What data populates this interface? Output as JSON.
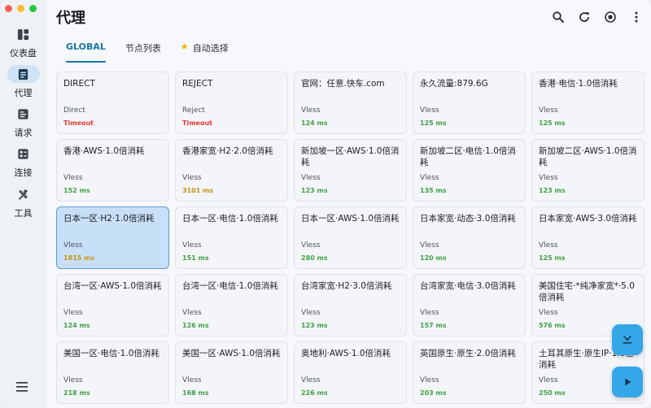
{
  "window": {
    "title": "代理"
  },
  "sidebar": {
    "items": [
      {
        "label": "仪表盘",
        "icon": "dashboard-icon",
        "active": false
      },
      {
        "label": "代理",
        "icon": "proxy-icon",
        "active": true
      },
      {
        "label": "请求",
        "icon": "requests-icon",
        "active": false
      },
      {
        "label": "连接",
        "icon": "connections-icon",
        "active": false
      },
      {
        "label": "工具",
        "icon": "tools-icon",
        "active": false
      }
    ],
    "menu_icon": "menu-icon"
  },
  "header": {
    "actions": [
      "search-icon",
      "refresh-icon",
      "target-icon",
      "more-vert-icon"
    ]
  },
  "tabs": [
    {
      "label": "GLOBAL",
      "active": true
    },
    {
      "label": "节点列表",
      "active": false
    },
    {
      "label": "自动选择",
      "active": false,
      "icon": "star-icon"
    }
  ],
  "nodes": [
    {
      "name": "DIRECT",
      "type": "Direct",
      "delay": "Timeout",
      "status": "bad"
    },
    {
      "name": "REJECT",
      "type": "Reject",
      "delay": "Timeout",
      "status": "bad"
    },
    {
      "name": "官网：任意.快车.com",
      "type": "Vless",
      "delay": "124 ms",
      "status": "good"
    },
    {
      "name": "永久流量:879.6G",
      "type": "Vless",
      "delay": "125 ms",
      "status": "good"
    },
    {
      "name": "香港·电信·1.0倍消耗",
      "type": "Vless",
      "delay": "125 ms",
      "status": "good"
    },
    {
      "name": "香港·AWS·1.0倍消耗",
      "type": "Vless",
      "delay": "152 ms",
      "status": "good"
    },
    {
      "name": "香港家宽·H2·2.0倍消耗",
      "type": "Vless",
      "delay": "3101 ms",
      "status": "warn"
    },
    {
      "name": "新加坡一区·AWS·1.0倍消耗",
      "type": "Vless",
      "delay": "123 ms",
      "status": "good"
    },
    {
      "name": "新加坡二区·电信·1.0倍消耗",
      "type": "Vless",
      "delay": "135 ms",
      "status": "good"
    },
    {
      "name": "新加坡二区·AWS·1.0倍消耗",
      "type": "Vless",
      "delay": "123 ms",
      "status": "good"
    },
    {
      "name": "日本一区·H2·1.0倍消耗",
      "type": "Vless",
      "delay": "1815 ms",
      "status": "warn",
      "selected": true
    },
    {
      "name": "日本一区·电信·1.0倍消耗",
      "type": "Vless",
      "delay": "151 ms",
      "status": "good"
    },
    {
      "name": "日本一区·AWS·1.0倍消耗",
      "type": "Vless",
      "delay": "280 ms",
      "status": "good"
    },
    {
      "name": "日本家宽·动态·3.0倍消耗",
      "type": "Vless",
      "delay": "120 ms",
      "status": "good"
    },
    {
      "name": "日本家宽·AWS·3.0倍消耗",
      "type": "Vless",
      "delay": "125 ms",
      "status": "good"
    },
    {
      "name": "台湾一区·AWS·1.0倍消耗",
      "type": "Vless",
      "delay": "124 ms",
      "status": "good"
    },
    {
      "name": "台湾一区·电信·1.0倍消耗",
      "type": "Vless",
      "delay": "126 ms",
      "status": "good"
    },
    {
      "name": "台湾家宽·H2·3.0倍消耗",
      "type": "Vless",
      "delay": "123 ms",
      "status": "good"
    },
    {
      "name": "台湾家宽·电信·3.0倍消耗",
      "type": "Vless",
      "delay": "157 ms",
      "status": "good"
    },
    {
      "name": "美国住宅·*纯净家宽*·5.0倍消耗",
      "type": "Vless",
      "delay": "576 ms",
      "status": "good"
    },
    {
      "name": "美国一区·电信·1.0倍消耗",
      "type": "Vless",
      "delay": "218 ms",
      "status": "good"
    },
    {
      "name": "美国一区·AWS·1.0倍消耗",
      "type": "Vless",
      "delay": "168 ms",
      "status": "good"
    },
    {
      "name": "奥地利·AWS·1.0倍消耗",
      "type": "Vless",
      "delay": "226 ms",
      "status": "good"
    },
    {
      "name": "英国原生·原生·2.0倍消耗",
      "type": "Vless",
      "delay": "203 ms",
      "status": "good"
    },
    {
      "name": "土耳其原生·原生IP·1.0倍消耗",
      "type": "Vless",
      "delay": "250 ms",
      "status": "good"
    }
  ],
  "fabs": [
    "collapse-icon",
    "play-icon"
  ],
  "colors": {
    "accent": "#1976a8",
    "fab": "#35a7e8",
    "selected": "#c8e0f7",
    "good": "#43a047",
    "warn": "#c79216",
    "bad": "#e53935"
  }
}
